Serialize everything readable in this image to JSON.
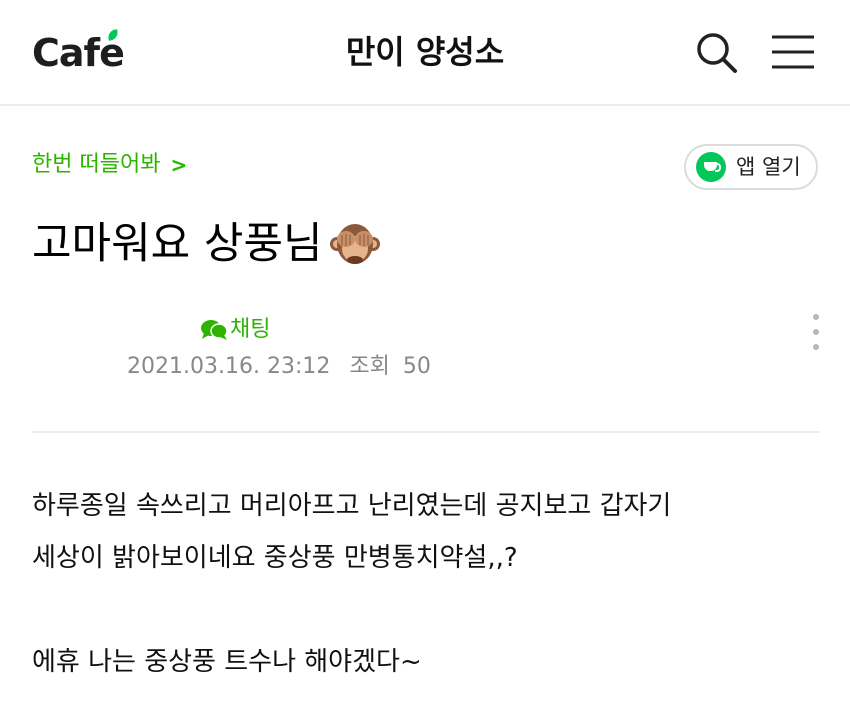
{
  "header": {
    "logo_text": "Cafe",
    "cafe_name": "만이 양성소",
    "icons": [
      "search-icon",
      "hamburger-menu-icon"
    ]
  },
  "post": {
    "board_name": "한번 떠들어봐",
    "board_chevron": ">",
    "app_open_label": "앱 열기",
    "title": "고마워요 상풍님",
    "title_emoji": "see-no-evil-monkey-emoji",
    "chat_label": "채팅",
    "date": "2021.03.16. 23:12",
    "views_label": "조회",
    "views_count": "50",
    "body_lines": [
      "하루종일 속쓰리고 머리아프고 난리였는데 공지보고 갑자기",
      "세상이 밝아보이네요 중상풍 만병통치약설,,?",
      "",
      "에휴 나는 중상풍 트수나 해야겠다~"
    ]
  },
  "colors": {
    "accent_green": "#2db400",
    "naver_green": "#03c75a",
    "meta_gray": "#888888",
    "divider": "#ececec"
  }
}
